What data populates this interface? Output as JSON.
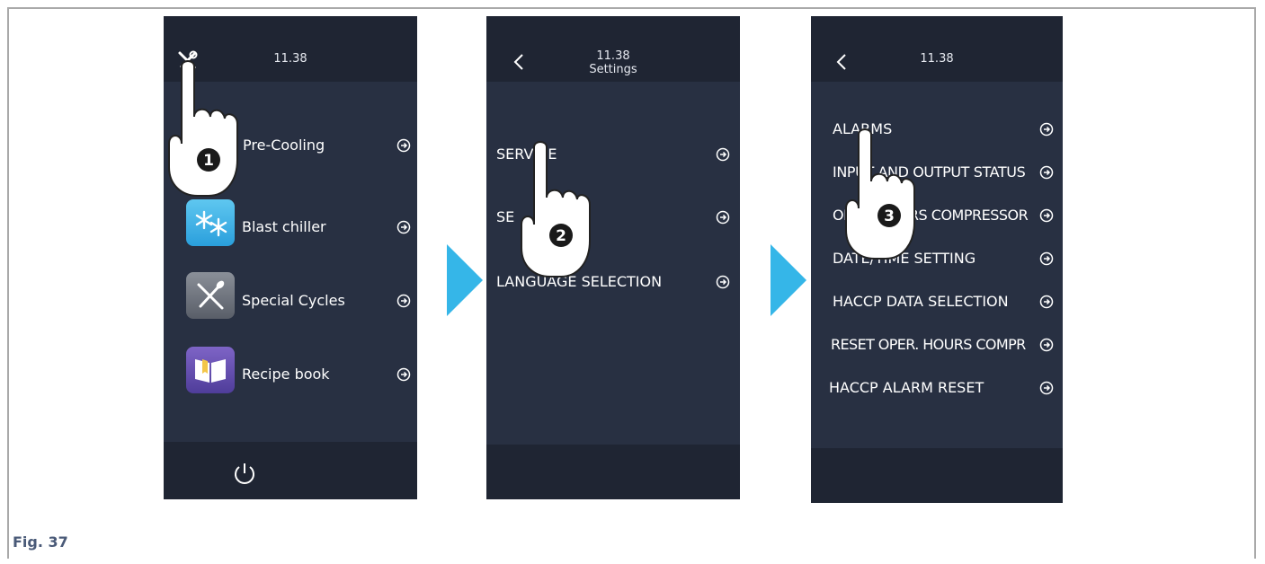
{
  "figure": {
    "caption": "Fig. 37"
  },
  "screen1": {
    "time": "11.38",
    "items": [
      {
        "label": "Pre-Cooling",
        "icon": "precooling-icon"
      },
      {
        "label": "Blast chiller",
        "icon": "snowflake-icon"
      },
      {
        "label": "Special Cycles",
        "icon": "fork-knife-icon"
      },
      {
        "label": "Recipe book",
        "icon": "book-icon"
      }
    ],
    "step": "1"
  },
  "screen2": {
    "time": "11.38",
    "title": "Settings",
    "items": [
      {
        "label": "SERVICE"
      },
      {
        "label": "SE"
      },
      {
        "label": "LANGUAGE SELECTION"
      }
    ],
    "step": "2"
  },
  "screen3": {
    "time": "11.38",
    "items": [
      {
        "label": "ALARMS"
      },
      {
        "label": "INPUT AND OUTPUT STATUS"
      },
      {
        "label": "OPER. HOURS COMPRESSOR"
      },
      {
        "label": "DATE/TIME SETTING"
      },
      {
        "label": "HACCP DATA SELECTION"
      },
      {
        "label": "RESET OPER. HOURS COMPR"
      },
      {
        "label": "HACCP ALARM RESET"
      }
    ],
    "step": "3"
  },
  "colors": {
    "screen_bg": "#283042",
    "bar_bg": "#1f2533",
    "arrow_accent": "#35b6e8"
  }
}
